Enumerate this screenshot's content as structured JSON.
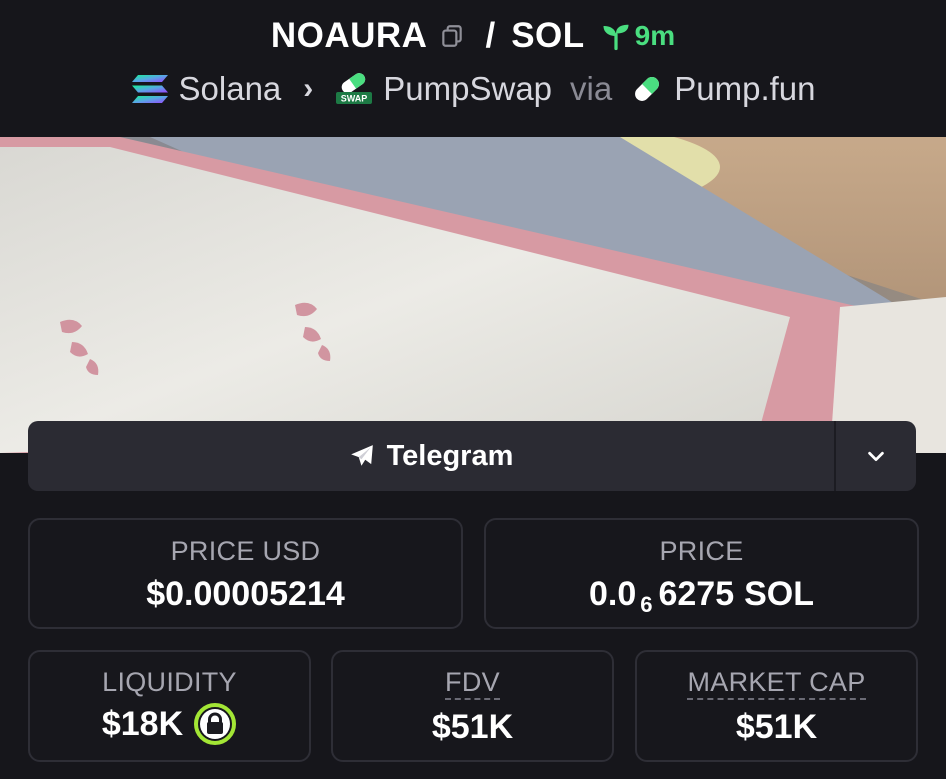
{
  "header": {
    "base_symbol": "NOAURA",
    "separator": "/",
    "quote_symbol": "SOL",
    "age": "9m",
    "chain": "Solana",
    "dex": "PumpSwap",
    "via_label": "via",
    "launchpad": "Pump.fun"
  },
  "social": {
    "telegram_label": "Telegram"
  },
  "stats": {
    "price_usd": {
      "label": "PRICE USD",
      "value": "$0.00005214"
    },
    "price_native": {
      "label": "PRICE",
      "prefix": "0.0",
      "zeros": "6",
      "digits": "6275",
      "unit": "SOL"
    },
    "liquidity": {
      "label": "LIQUIDITY",
      "value": "$18K"
    },
    "fdv": {
      "label": "FDV",
      "value": "$51K"
    },
    "market_cap": {
      "label": "MARKET CAP",
      "value": "$51K"
    }
  },
  "colors": {
    "background": "#16161b",
    "accent_green": "#4ade80",
    "card_border": "#2e2e36",
    "button_bg": "#2b2b33"
  },
  "icons": {
    "copy": "copy-icon",
    "age": "seedling-icon",
    "chain": "solana-logo-icon",
    "dex": "pumpswap-logo-icon",
    "launchpad": "pumpfun-pill-icon",
    "telegram": "paper-plane-icon",
    "dropdown": "chevron-down-icon",
    "liquidity_lock": "lock-icon"
  }
}
